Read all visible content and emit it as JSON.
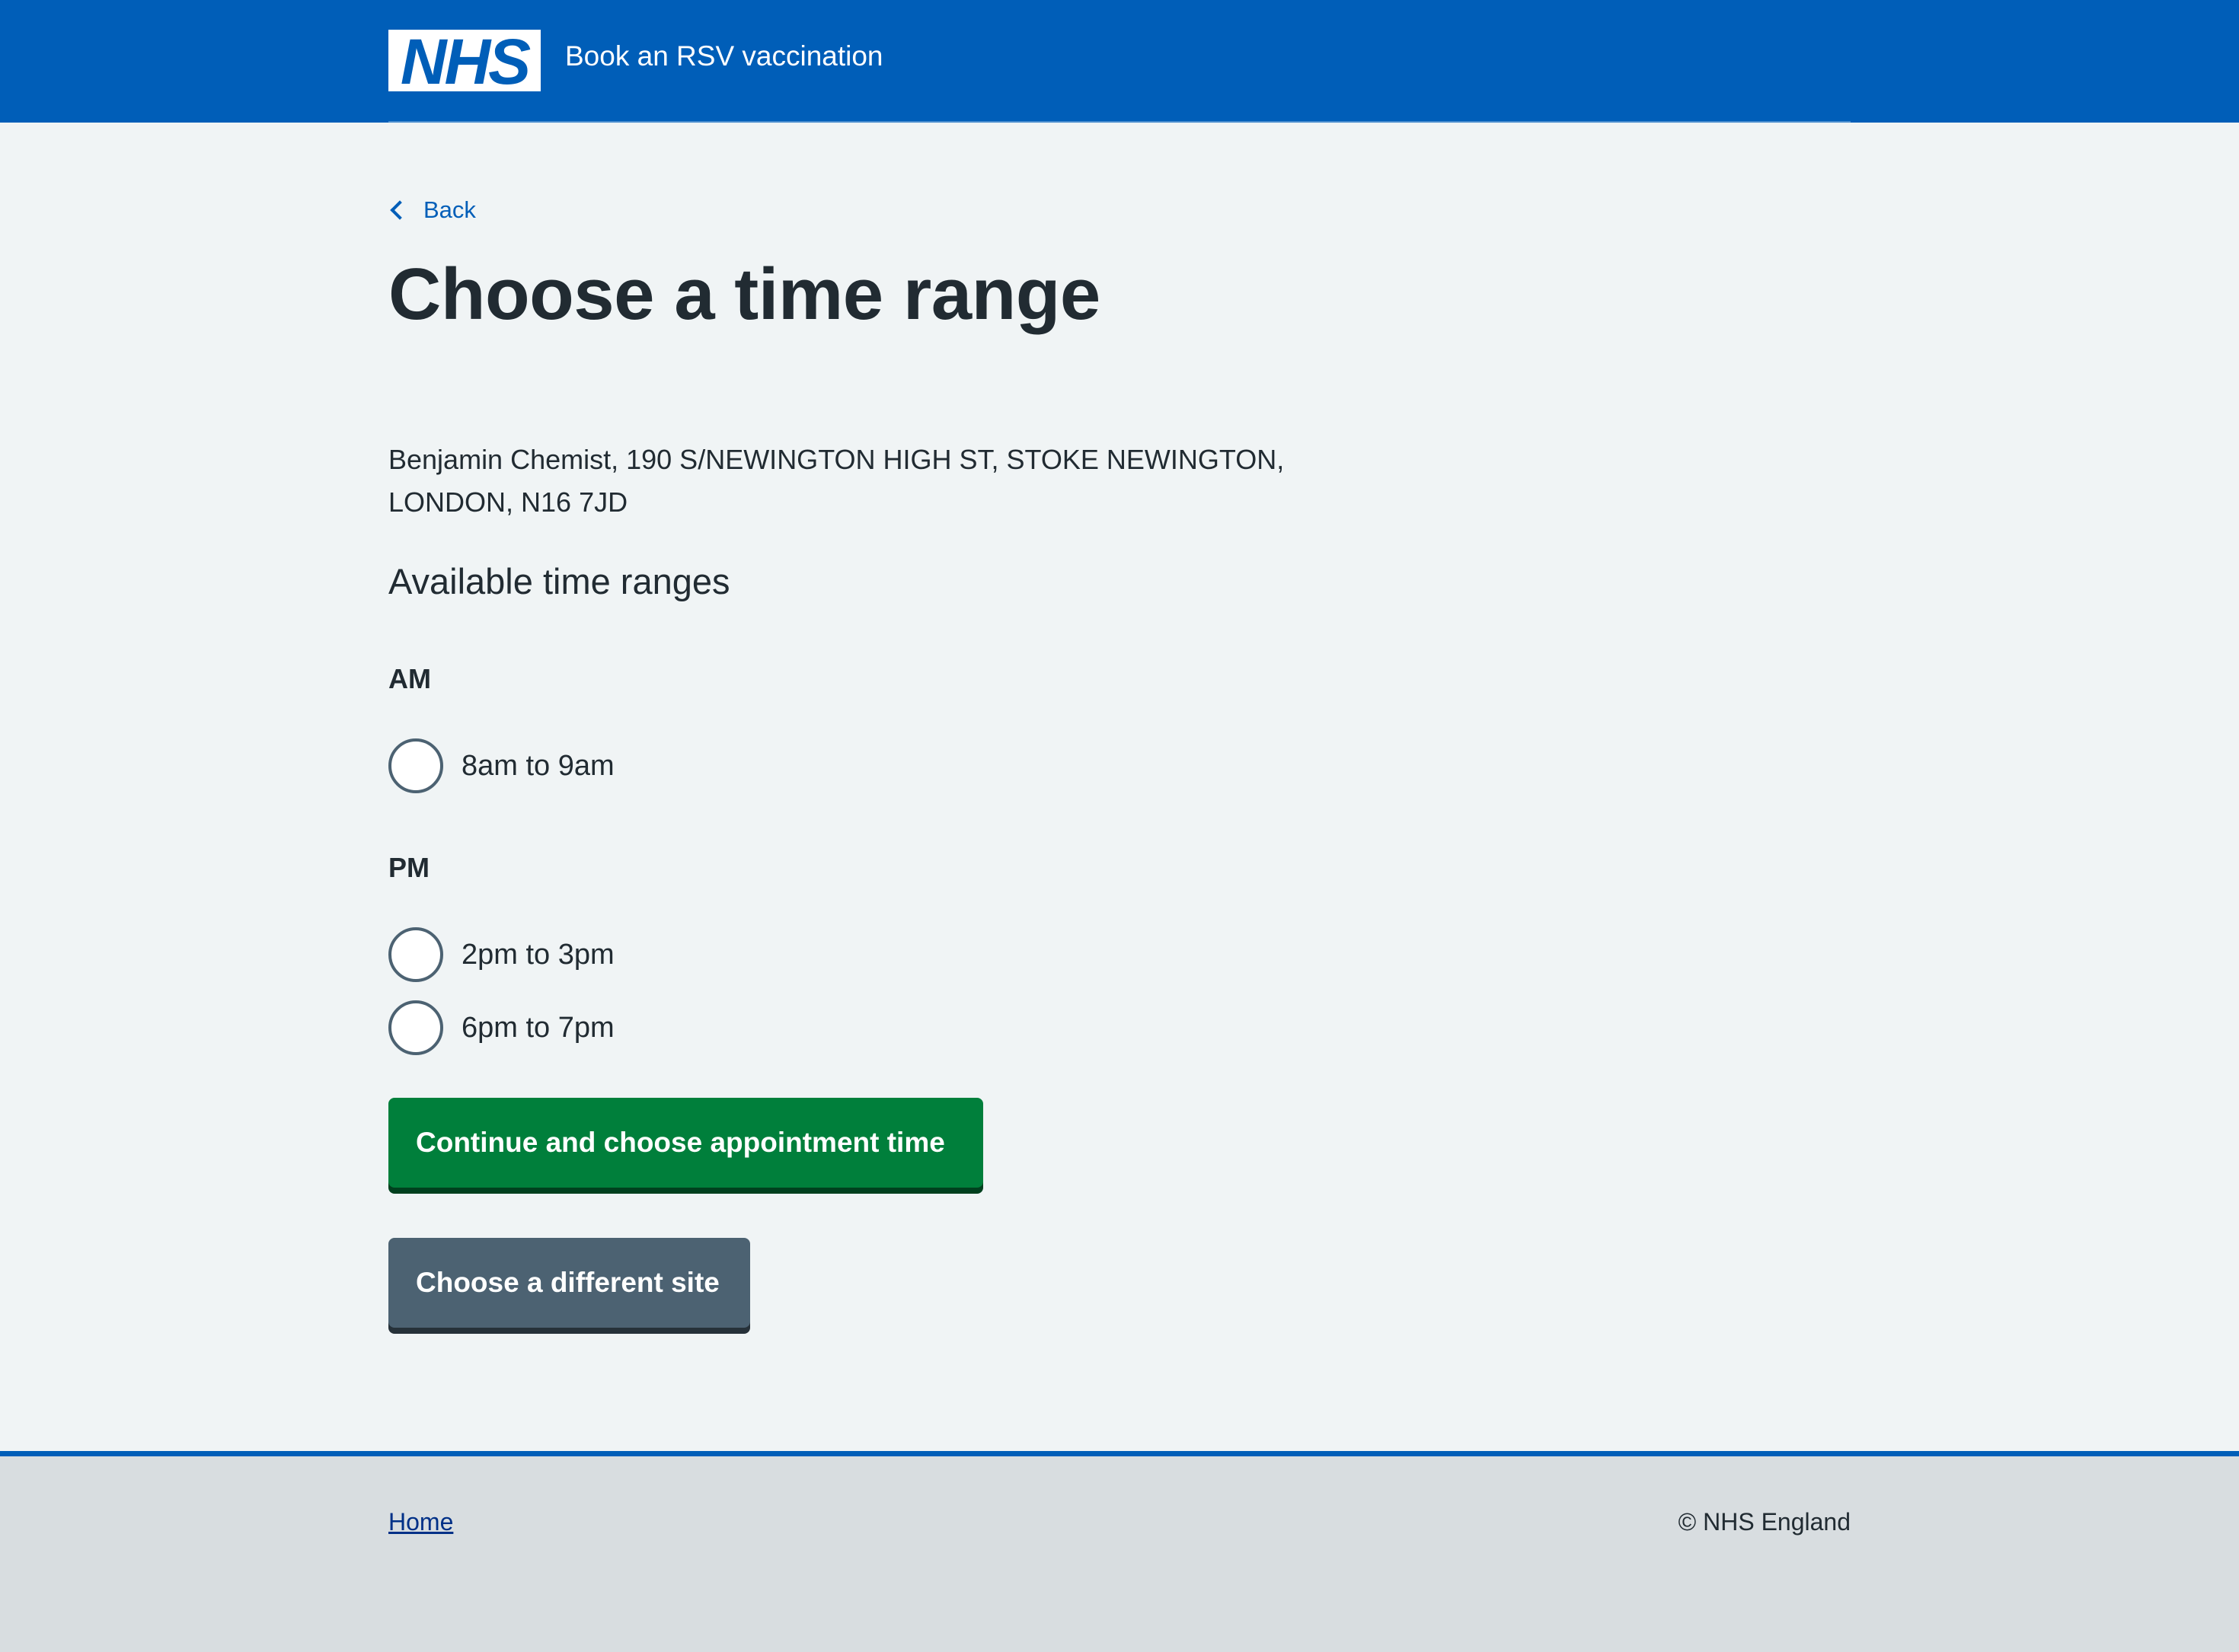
{
  "header": {
    "logo_text": "NHS",
    "service_name": "Book an RSV vaccination",
    "brand_color": "#005eb8"
  },
  "nav": {
    "back_label": "Back"
  },
  "page": {
    "title": "Choose a time range",
    "address": "Benjamin Chemist, 190 S/NEWINGTON HIGH ST, STOKE NEWINGTON, LONDON, N16 7JD",
    "legend": "Available time ranges"
  },
  "time_groups": [
    {
      "label": "AM",
      "options": [
        "8am to 9am"
      ]
    },
    {
      "label": "PM",
      "options": [
        "2pm to 3pm",
        "6pm to 7pm"
      ]
    }
  ],
  "actions": {
    "continue_label": "Continue and choose appointment time",
    "continue_color": "#007f3b",
    "different_site_label": "Choose a different site",
    "different_site_color": "#4c6272"
  },
  "footer": {
    "home_link": "Home",
    "copyright": "© NHS England"
  }
}
